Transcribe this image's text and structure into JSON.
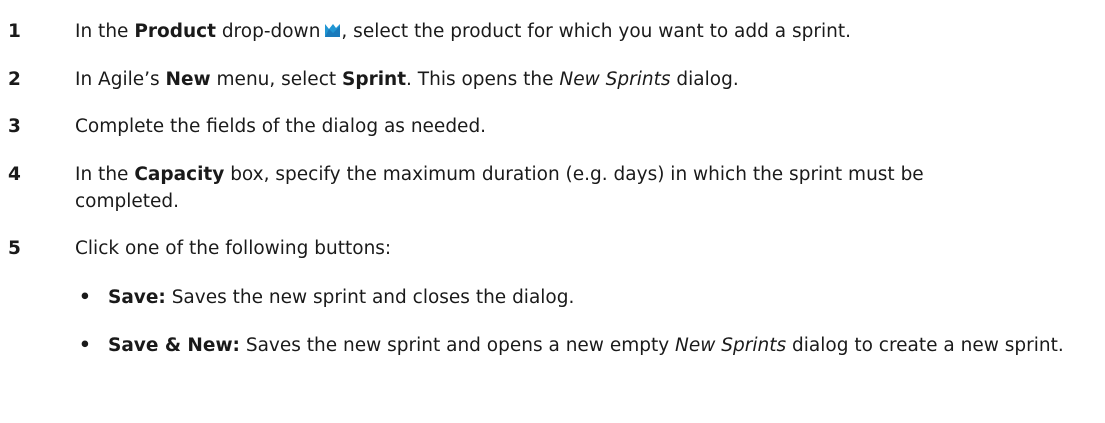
{
  "steps": [
    {
      "number": "1",
      "before": "In the ",
      "bold": "Product",
      "middle": " drop-down",
      "icon": "product-dropdown-icon",
      "after": ", select the product for which you want to add a sprint."
    },
    {
      "number": "2",
      "before": "In Agile’s ",
      "bold1": "New",
      "middle": " menu, select ",
      "bold2": "Sprint",
      "after1": ". This opens the ",
      "italic": "New Sprints",
      "after2": " dialog."
    },
    {
      "number": "3",
      "text": "Complete the fields of the dialog as needed."
    },
    {
      "number": "4",
      "before": "In the ",
      "bold": "Capacity",
      "after": " box, specify the maximum duration (e.g. days) in which the sprint must be completed."
    },
    {
      "number": "5",
      "text": "Click one of the following buttons:"
    }
  ],
  "bullets": [
    {
      "symbol": "•",
      "bold": "Save:",
      "text": " Saves the new sprint and closes the dialog."
    },
    {
      "symbol": "•",
      "bold": "Save & New:",
      "text1": " Saves the new sprint and opens a new empty ",
      "italic": "New Sprints",
      "text2": " dialog to create a new sprint."
    }
  ],
  "colors": {
    "text": "#1a1a1a",
    "icon": "#2196d3"
  }
}
